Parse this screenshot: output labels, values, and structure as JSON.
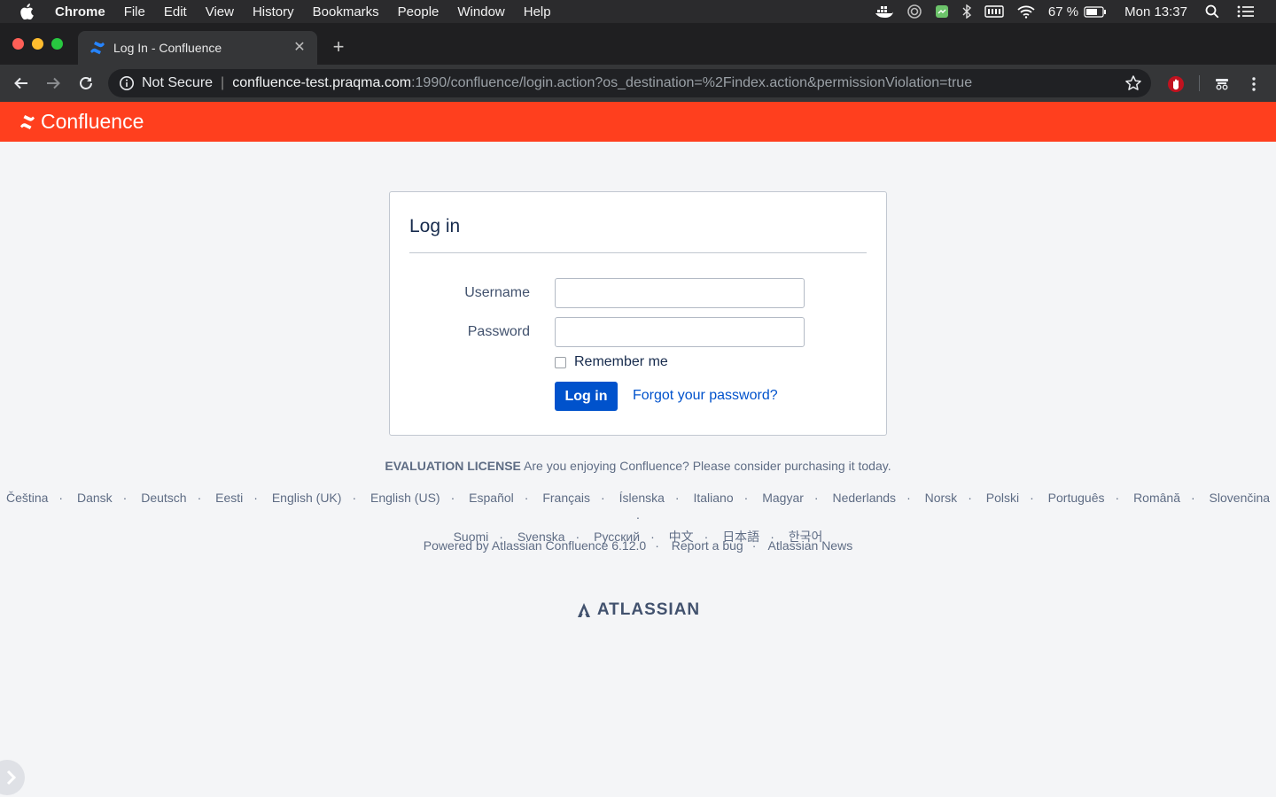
{
  "menubar": {
    "app": "Chrome",
    "items": [
      "File",
      "Edit",
      "View",
      "History",
      "Bookmarks",
      "People",
      "Window",
      "Help"
    ],
    "battery": "67 %",
    "clock": "Mon 13:37"
  },
  "browser": {
    "tab_title": "Log In - Confluence",
    "not_secure": "Not Secure",
    "url_host": "confluence-test.praqma.com",
    "url_path": ":1990/confluence/login.action?os_destination=%2Findex.action&permissionViolation=true"
  },
  "header": {
    "logo_text": "Confluence"
  },
  "login": {
    "title": "Log in",
    "username_label": "Username",
    "username_value": "",
    "password_label": "Password",
    "password_value": "",
    "remember_label": "Remember me",
    "remember_checked": false,
    "submit_label": "Log in",
    "forgot_label": "Forgot your password?"
  },
  "footer": {
    "eval_strong": "EVALUATION LICENSE",
    "eval_text": "Are you enjoying Confluence? Please consider purchasing it today.",
    "languages_row1": [
      "Čeština",
      "Dansk",
      "Deutsch",
      "Eesti",
      "English (UK)",
      "English (US)",
      "Español",
      "Français",
      "Íslenska",
      "Italiano",
      "Magyar",
      "Nederlands",
      "Norsk",
      "Polski",
      "Português",
      "Română",
      "Slovenčina"
    ],
    "languages_row2": [
      "Suomi",
      "Svenska",
      "Русский",
      "中文",
      "日本語",
      "한국어"
    ],
    "powered_by": "Powered by Atlassian Confluence 6.12.0",
    "report_bug": "Report a bug",
    "atlassian_news": "Atlassian News",
    "brand": "ATLASSIAN"
  },
  "colors": {
    "confluence_red": "#ff3f1e",
    "primary_blue": "#0052cc",
    "page_bg": "#f4f5f7"
  },
  "icons": [
    "apple-logo-icon",
    "confluence-favicon-icon",
    "back-arrow-icon",
    "forward-arrow-icon",
    "reload-icon",
    "info-icon",
    "star-icon",
    "ublock-icon",
    "extension-icon",
    "more-vert-icon",
    "wifi-icon",
    "battery-icon",
    "search-icon",
    "list-icon",
    "atlassian-logo-icon"
  ]
}
